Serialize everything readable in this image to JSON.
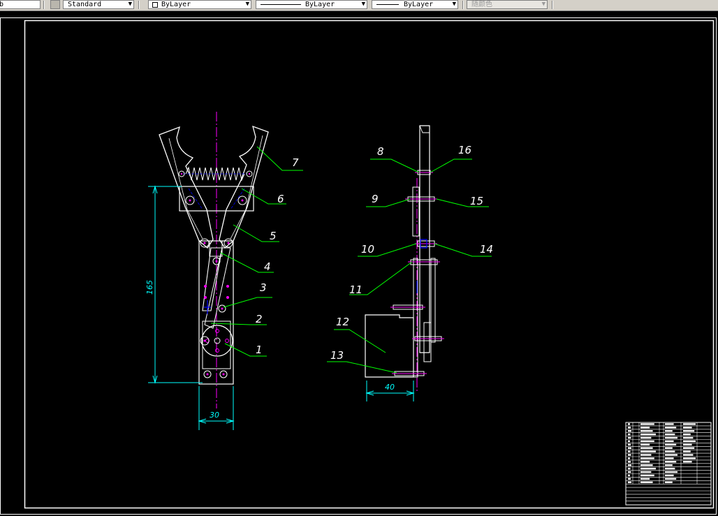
{
  "toolbar": {
    "text_style": "Standard",
    "layer": "ByLayer",
    "linetype": "ByLayer",
    "lineweight": "ByLayer",
    "plot_style": "随颜色",
    "text_style_icon": "text-style-icon",
    "dropdown_icon": "chevron-down-icon"
  },
  "colors": {
    "background": "#000000",
    "part_outline": "#ffffff",
    "leader": "#00ff00",
    "dimension": "#00ffff",
    "centerline": "#ff00ff",
    "hidden": "#0000ff",
    "frame": "#ffffff"
  },
  "drawing": {
    "front_view": {
      "labels": [
        "1",
        "2",
        "3",
        "4",
        "5",
        "6",
        "7"
      ],
      "dim_height": "165",
      "dim_width": "30"
    },
    "side_view": {
      "labels": [
        "8",
        "9",
        "10",
        "11",
        "12",
        "13",
        "14",
        "15",
        "16"
      ],
      "dim_width": "40"
    }
  }
}
